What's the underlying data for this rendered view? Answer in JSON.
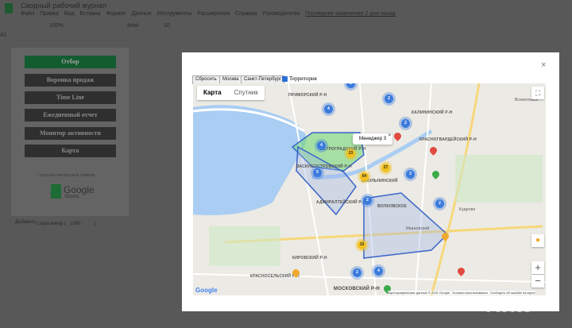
{
  "app": {
    "title": "Сводный рабочий журнал",
    "menu": [
      "Файл",
      "Правка",
      "Вид",
      "Вставка",
      "Формат",
      "Данные",
      "Инструменты",
      "Расширения",
      "Справка",
      "Руководителю"
    ],
    "last_edit": "Последнее изменение 2 дня назад",
    "cell_ref": "A1",
    "zoom": "100%",
    "font": "Arial",
    "font_size": "10"
  },
  "sheet": {
    "buttons": [
      "Отбор",
      "Воронка продаж",
      "Time Line",
      "Ежедневный отчет",
      "Монитор активности",
      "Карта"
    ],
    "checkbox_label": "... получать интересные новинки",
    "logo_text": "Google",
    "logo_sub": "Sheets",
    "add_button": "Добавить",
    "add_rows_label": "строк внизу (",
    "add_rows_value": "1000",
    "add_rows_end": ")."
  },
  "modal": {
    "close": "×",
    "controls": {
      "reset": "Сбросить",
      "moscow": "Москва",
      "spb": "Санкт-Петербург",
      "territory": "Территория",
      "territory_checked": true
    },
    "map": {
      "tabs": [
        "Карта",
        "Спутник"
      ],
      "popup": "Менеджер 3",
      "popup_close": "×",
      "zoom_in": "+",
      "zoom_out": "−",
      "districts": [
        "ПРИМОРСКИЙ Р-Н",
        "КАЛИНИНСКИЙ Р-Н",
        "КРАСНОГВАРДЕЙСКИЙ Р-Н",
        "ПЕТРОГРАДСКИЙ Р-Н",
        "ВАСИЛЕОСТРОВСКИЙ Р-Н",
        "АДМИРАЛТЕЙСКИЙ Р-Н",
        "ВОЛКОВСКОЕ",
        "КИРОВСКИЙ Р-Н",
        "КРАСНОСЕЛЬСКИЙ Р-Н",
        "МОСКОВСКИЙ Р-Н",
        "Всеволожск",
        "СМОЛЬНИНСКИЙ",
        "Кудрово",
        "Ивановский"
      ],
      "clusters": [
        "2",
        "2",
        "4",
        "2",
        "4",
        "23",
        "5",
        "27",
        "64",
        "3",
        "2",
        "2",
        "10",
        "2",
        "4"
      ],
      "attribution": [
        "Картографические данные © 2021 Google",
        "Условия использования",
        "Сообщить об ошибке на карте"
      ],
      "logo": "Google"
    }
  },
  "watermark": "Avito"
}
